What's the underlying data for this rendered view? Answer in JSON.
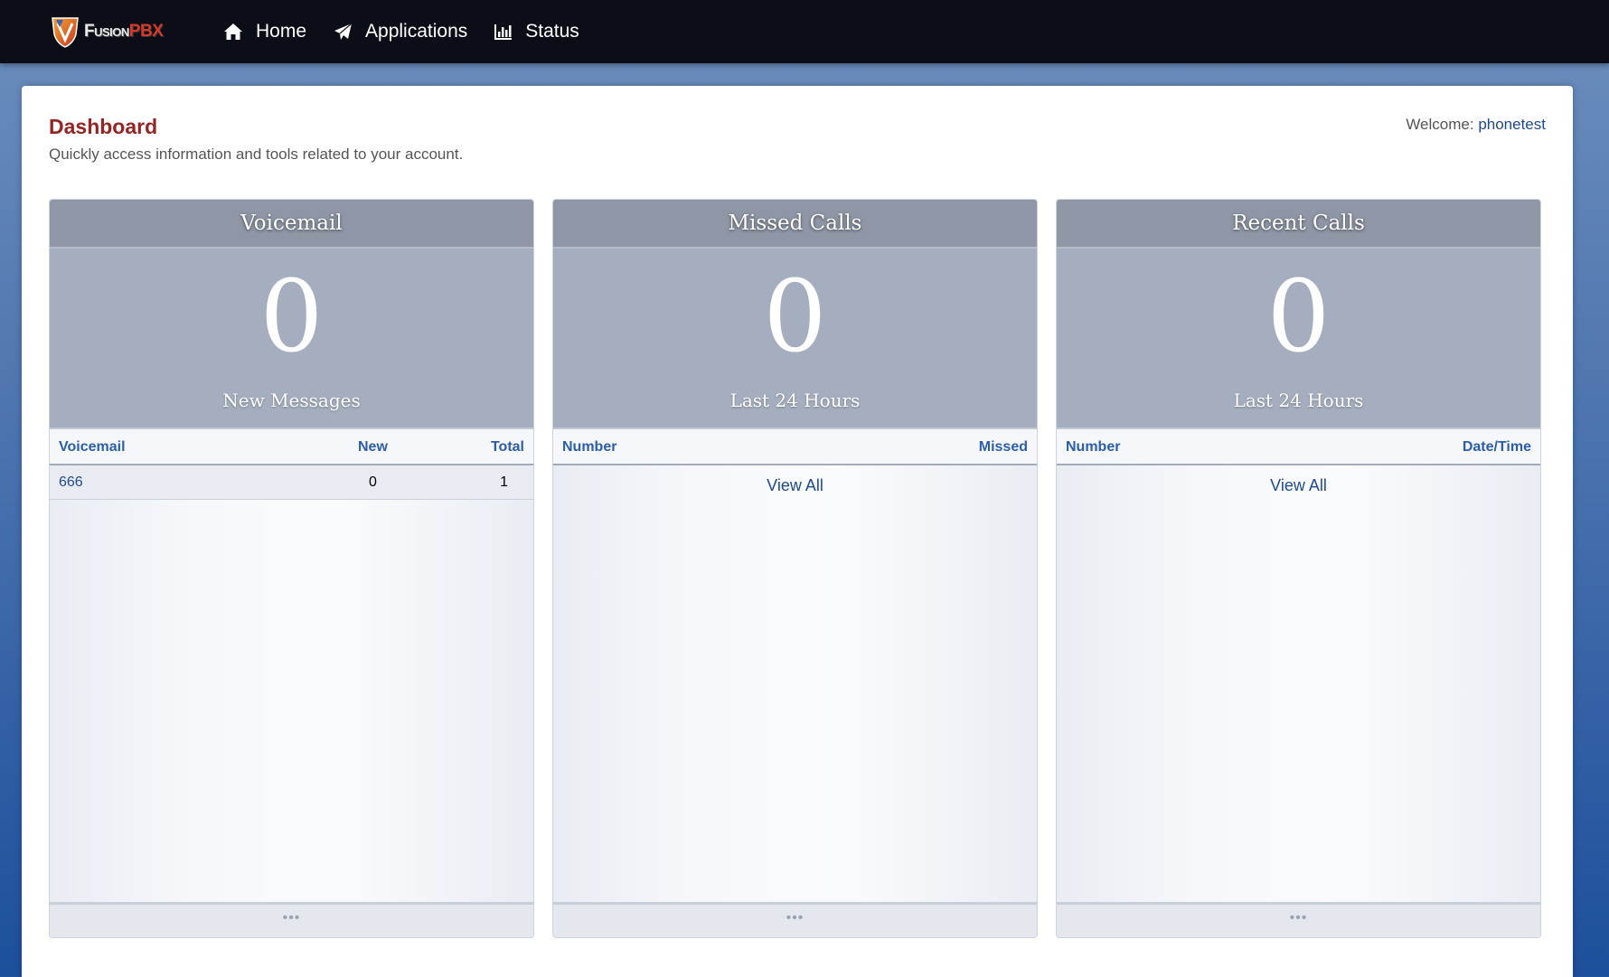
{
  "app": {
    "logo_fusion": "Fusion",
    "logo_pbx": "PBX"
  },
  "nav": {
    "items": [
      {
        "label": "Home",
        "icon": "home-icon"
      },
      {
        "label": "Applications",
        "icon": "paper-plane-icon"
      },
      {
        "label": "Status",
        "icon": "bar-chart-icon"
      }
    ]
  },
  "page": {
    "title": "Dashboard",
    "description": "Quickly access information and tools related to your account.",
    "welcome_label": "Welcome:",
    "username": "phonetest"
  },
  "widgets": {
    "voicemail": {
      "title": "Voicemail",
      "count": "0",
      "count_label": "New Messages",
      "columns": [
        "Voicemail",
        "New",
        "Total"
      ],
      "rows": [
        {
          "voicemail": "666",
          "new": "0",
          "total": "1"
        }
      ],
      "footer": "•••"
    },
    "missed_calls": {
      "title": "Missed Calls",
      "count": "0",
      "count_label": "Last 24 Hours",
      "columns": [
        "Number",
        "Missed"
      ],
      "view_all": "View All",
      "footer": "•••"
    },
    "recent_calls": {
      "title": "Recent Calls",
      "count": "0",
      "count_label": "Last 24 Hours",
      "columns": [
        "Number",
        "Date/Time"
      ],
      "view_all": "View All",
      "footer": "•••"
    }
  },
  "colors": {
    "navbar": "#0b0e16",
    "title": "#952424",
    "link": "#1f4a8a",
    "widget_header": "#8f97a6",
    "widget_counter": "#a5aebe"
  }
}
